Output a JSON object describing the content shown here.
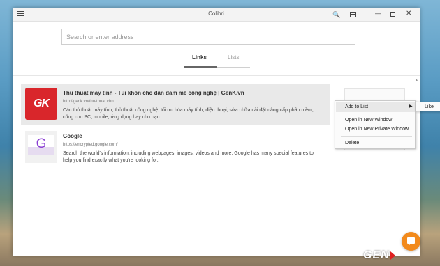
{
  "window": {
    "title": "Colibri"
  },
  "address_bar": {
    "placeholder": "Search or enter address",
    "value": ""
  },
  "tabs": [
    {
      "label": "Links",
      "active": true
    },
    {
      "label": "Lists",
      "active": false
    }
  ],
  "links": [
    {
      "title": "Thủ thuật máy tính - Tùi khôn cho dân đam mê công nghệ | GenK.vn",
      "url": "http://genk.vn/thu-thuat.chn",
      "description": "Các thủ thuật máy tính, thủ thuật công nghệ, tối ưu hóa máy tính, điện thoại, sửa chữa cài đặt nâng cấp phần mềm, cũng cho PC, mobile, ứng dụng hay cho bạn",
      "thumbnail_text": "GK",
      "thumbnail_color": "#d9262b"
    },
    {
      "title": "Google",
      "url": "https://encrypted.google.com/",
      "description": "Search the world's information, including webpages, images, videos and more. Google has many special features to help you find exactly what you're looking for.",
      "thumbnail_text": "G",
      "thumbnail_color": "#8b3fd3"
    }
  ],
  "context_menu": {
    "add_to_list": "Add to List",
    "open_new_window": "Open in New Window",
    "open_private_window": "Open in New Private Window",
    "delete": "Delete"
  },
  "submenu": {
    "item": "Like"
  },
  "brand_logo": {
    "text": "GEN"
  },
  "colors": {
    "accent": "#f28a1c",
    "brand_red": "#d9262b"
  },
  "icons": {
    "menu": "menu-icon",
    "search": "search-icon",
    "reader": "reader-view-icon",
    "fab": "chat-bubble-icon"
  }
}
